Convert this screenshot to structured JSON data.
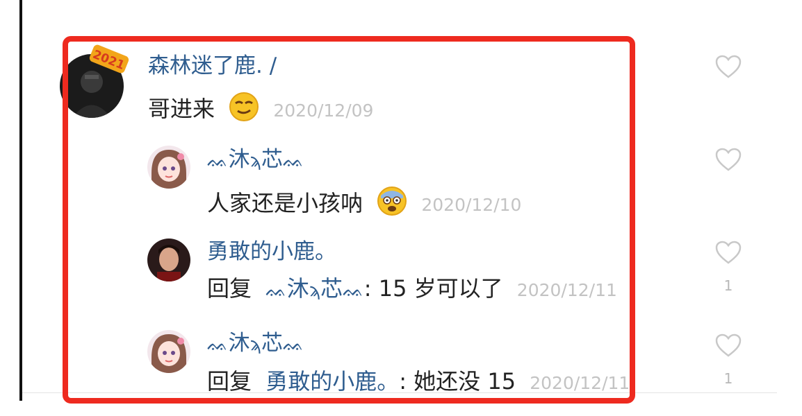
{
  "comments": [
    {
      "user": "森林迷了鹿. /",
      "text": "哥进来",
      "date": "2020/12/09",
      "likes": null,
      "avatar_badge": "2021"
    },
    {
      "user_left": "ᨐ",
      "user": "沐",
      "user_mid": "ϡ",
      "user2": "芯",
      "user_right": "ᨐ",
      "text": "人家还是小孩呐",
      "date": "2020/12/10",
      "likes": null
    },
    {
      "user": "勇敢的小鹿。",
      "reply_prefix": "回复",
      "reply_to_a": "沐",
      "reply_to_b": "芯",
      "text": ": 15 岁可以了",
      "date": "2020/12/11",
      "likes": "1"
    },
    {
      "user_left": "ᨐ",
      "user": "沐",
      "user_mid": "ϡ",
      "user2": "芯",
      "user_right": "ᨐ",
      "reply_prefix": "回复",
      "reply_to": "勇敢的小鹿。",
      "text": ": 她还没 15",
      "date": "2020/12/11",
      "likes": "1"
    }
  ],
  "colors": {
    "username": "#2f5d8f",
    "highlight": "#ee2a1f",
    "date": "#c3c3c3"
  }
}
